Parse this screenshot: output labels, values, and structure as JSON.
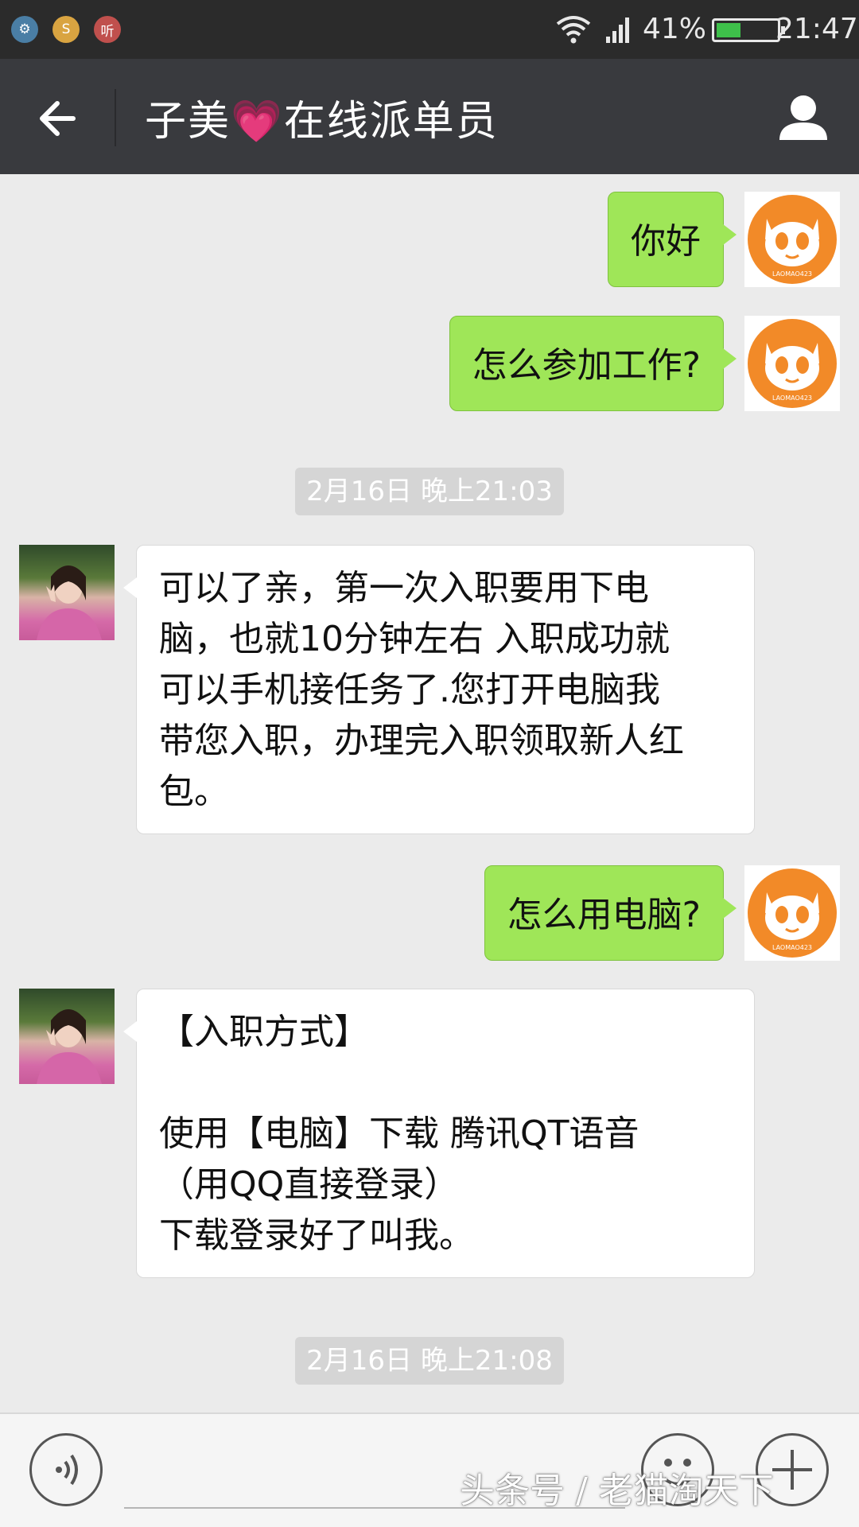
{
  "status_bar": {
    "battery_text": "41%",
    "battery_level": 0.41,
    "time": "21:47",
    "notification_icons": [
      "android-robot-icon",
      "app-s-icon",
      "listen-app-icon"
    ],
    "notification_glyphs": [
      "⚙",
      "S",
      "听"
    ]
  },
  "header": {
    "title": "子美💗在线派单员"
  },
  "messages": [
    {
      "side": "me",
      "lines": [
        "你好"
      ]
    },
    {
      "side": "me",
      "lines": [
        "怎么参加工作?"
      ]
    },
    {
      "side": "system",
      "timestamp": "2月16日 晚上21:03"
    },
    {
      "side": "them",
      "lines": [
        "可以了亲，第一次入职要用下电",
        "脑，也就10分钟左右 入职成功就",
        "可以手机接任务了.您打开电脑我",
        "带您入职，办理完入职领取新人红",
        "包。"
      ]
    },
    {
      "side": "me",
      "lines": [
        "怎么用电脑?"
      ]
    },
    {
      "side": "them",
      "lines": [
        "【入职方式】",
        "",
        "使用【电脑】下载 腾讯QT语音",
        "（用QQ直接登录）",
        "下载登录好了叫我。"
      ]
    },
    {
      "side": "system",
      "timestamp": "2月16日 晚上21:08"
    }
  ],
  "avatars": {
    "me_caption": "LAOMAO423"
  },
  "watermark": "头条号 / 老猫淘天下",
  "colors": {
    "my_bubble": "#9fe658",
    "their_bubble": "#ffffff",
    "header_bg": "#393a3e",
    "chat_bg": "#ebebeb"
  }
}
